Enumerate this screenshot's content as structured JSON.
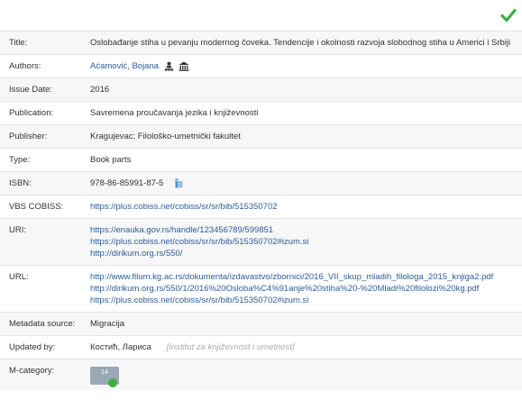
{
  "colors": {
    "link": "#2a5d9c",
    "check": "#3cb043",
    "badge": "#9aa7b5"
  },
  "status_icon": "checkmark-icon",
  "rows": {
    "title": {
      "label": "Title:",
      "value": "Oslobađanje stiha u pevanju modernog čoveka. Tendencije i okolnosti razvoja slobodnog stiha u Americi i Srbiji"
    },
    "authors": {
      "label": "Authors:",
      "value": "Aćamović, Bojana",
      "icons": [
        "person-network-icon",
        "institution-icon"
      ]
    },
    "issue_date": {
      "label": "Issue Date:",
      "value": "2016"
    },
    "publication": {
      "label": "Publication:",
      "value": "Savremena proučavanja jezika i književnosti"
    },
    "publisher": {
      "label": "Publisher:",
      "value": "Kragujevac: Filološko-umetnički fakultet"
    },
    "type": {
      "label": "Type:",
      "value": "Book parts"
    },
    "isbn": {
      "label": "ISBN:",
      "value": "978-86-85991-87-5",
      "icon": "isbn-lookup-icon"
    },
    "vbs_cobiss": {
      "label": "VBS COBISS:",
      "value": "https://plus.cobiss.net/cobiss/sr/sr/bib/515350702"
    },
    "uri": {
      "label": "URI:",
      "links": [
        "https://enauka.gov.rs/handle/123456789/599851",
        "https://plus.cobiss.net/cobiss/sr/sr/bib/515350702#izum.si",
        "http://dirikum.org.rs/550/"
      ]
    },
    "url": {
      "label": "URL:",
      "links": [
        "http://www.filum.kg.ac.rs/dokumenta/izdavastvo/zbornici/2016_VII_skup_mladih_filologa_2015_knjiga2.pdf",
        "http://dirikum.org.rs/550/1/2016%20Osloba%C4%91anje%20stiha%20-%20Mladi%20filolozi%20kg.pdf",
        "https://plus.cobiss.net/cobiss/sr/sr/bib/515350702#izum.si"
      ]
    },
    "metadata_source": {
      "label": "Metadata source:",
      "value": "Migracija"
    },
    "updated_by": {
      "label": "Updated by:",
      "value": "Костић, Лариса",
      "institution": "[Institut za književnost i umetnost]"
    },
    "m_category": {
      "label": "M-category:",
      "badge": "14"
    }
  }
}
